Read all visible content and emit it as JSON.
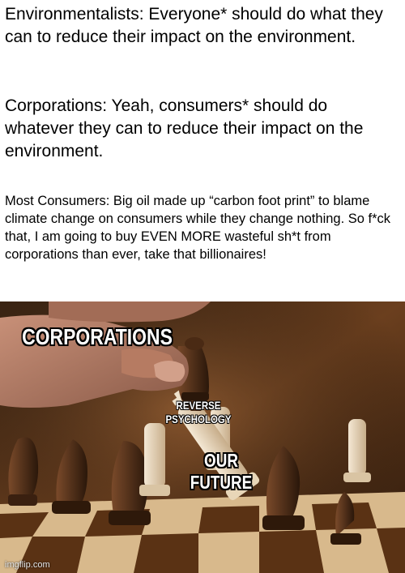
{
  "meme": {
    "panel_top": {
      "line1": "Environmentalists: Everyone* should do what they can to reduce their impact on the environment.",
      "line2": "Corporations: Yeah, consumers* should do whatever they can to reduce their impact on the environment.",
      "line3": "Most Consumers: Big oil made up “carbon foot print” to blame climate change on consumers while they change nothing. So f*ck that, I am going to buy EVEN MORE wasteful sh*t from corporations than ever, take that billionaires!"
    },
    "panel_image": {
      "caption_hand": "CORPORATIONS",
      "caption_piece_line1": "REVERSE",
      "caption_piece_line2": "PSYCHOLOGY",
      "caption_king_line1": "OUR",
      "caption_king_line2": "FUTURE",
      "watermark": "imgflip.com"
    }
  },
  "colors": {
    "background": "#ffffff",
    "caption_fill": "#ffffff",
    "caption_outline": "#000000",
    "board_light": "#d8b98c",
    "board_dark": "#5a3214"
  }
}
